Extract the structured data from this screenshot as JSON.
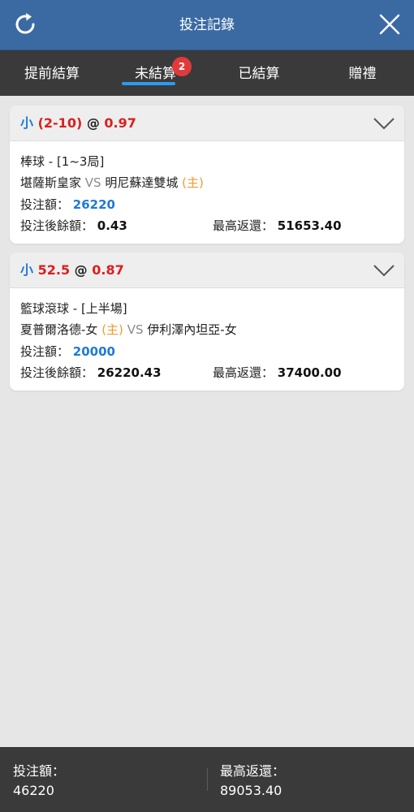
{
  "header": {
    "title": "投注記錄"
  },
  "tabs": [
    {
      "label": "提前結算"
    },
    {
      "label": "未結算",
      "badge": "2"
    },
    {
      "label": "已結算"
    },
    {
      "label": "贈禮"
    }
  ],
  "bets": [
    {
      "selection": "小",
      "line": "(2-10)",
      "at": "@",
      "odds": "0.97",
      "league": "棒球 - [1~3局]",
      "home_team": "堪薩斯皇家",
      "vs": "VS",
      "away_team": "明尼蘇達雙城",
      "home_mark": "(主)",
      "stake_label": "投注額：",
      "stake": "26220",
      "balance_label": "投注後餘額：",
      "balance": "0.43",
      "max_return_label": "最高返還：",
      "max_return": "51653.40"
    },
    {
      "selection": "小",
      "line": "52.5",
      "at": "@",
      "odds": "0.87",
      "league": "籃球滾球 - [上半場]",
      "home_team": "夏普爾洛德-女",
      "home_mark": "(主)",
      "vs": "VS",
      "away_team": "伊利澤內坦亞-女",
      "stake_label": "投注額：",
      "stake": "20000",
      "balance_label": "投注後餘額：",
      "balance": "26220.43",
      "max_return_label": "最高返還：",
      "max_return": "37400.00"
    }
  ],
  "footer": {
    "stake_label": "投注額：",
    "stake_total": "46220",
    "max_return_label": "最高返還：",
    "max_return_total": "89053.40"
  },
  "icons": {
    "refresh": "refresh-icon",
    "close": "close-icon",
    "expand": "chevron-down-icon"
  },
  "colors": {
    "header_bg": "#3b6aa3",
    "tab_bar_bg": "#3a3a3a",
    "active_underline": "#2a9cf0",
    "badge": "#e03a3a",
    "selection_blue": "#1f7ad6",
    "odds_red": "#d92020",
    "home_orange": "#f29a2e"
  }
}
